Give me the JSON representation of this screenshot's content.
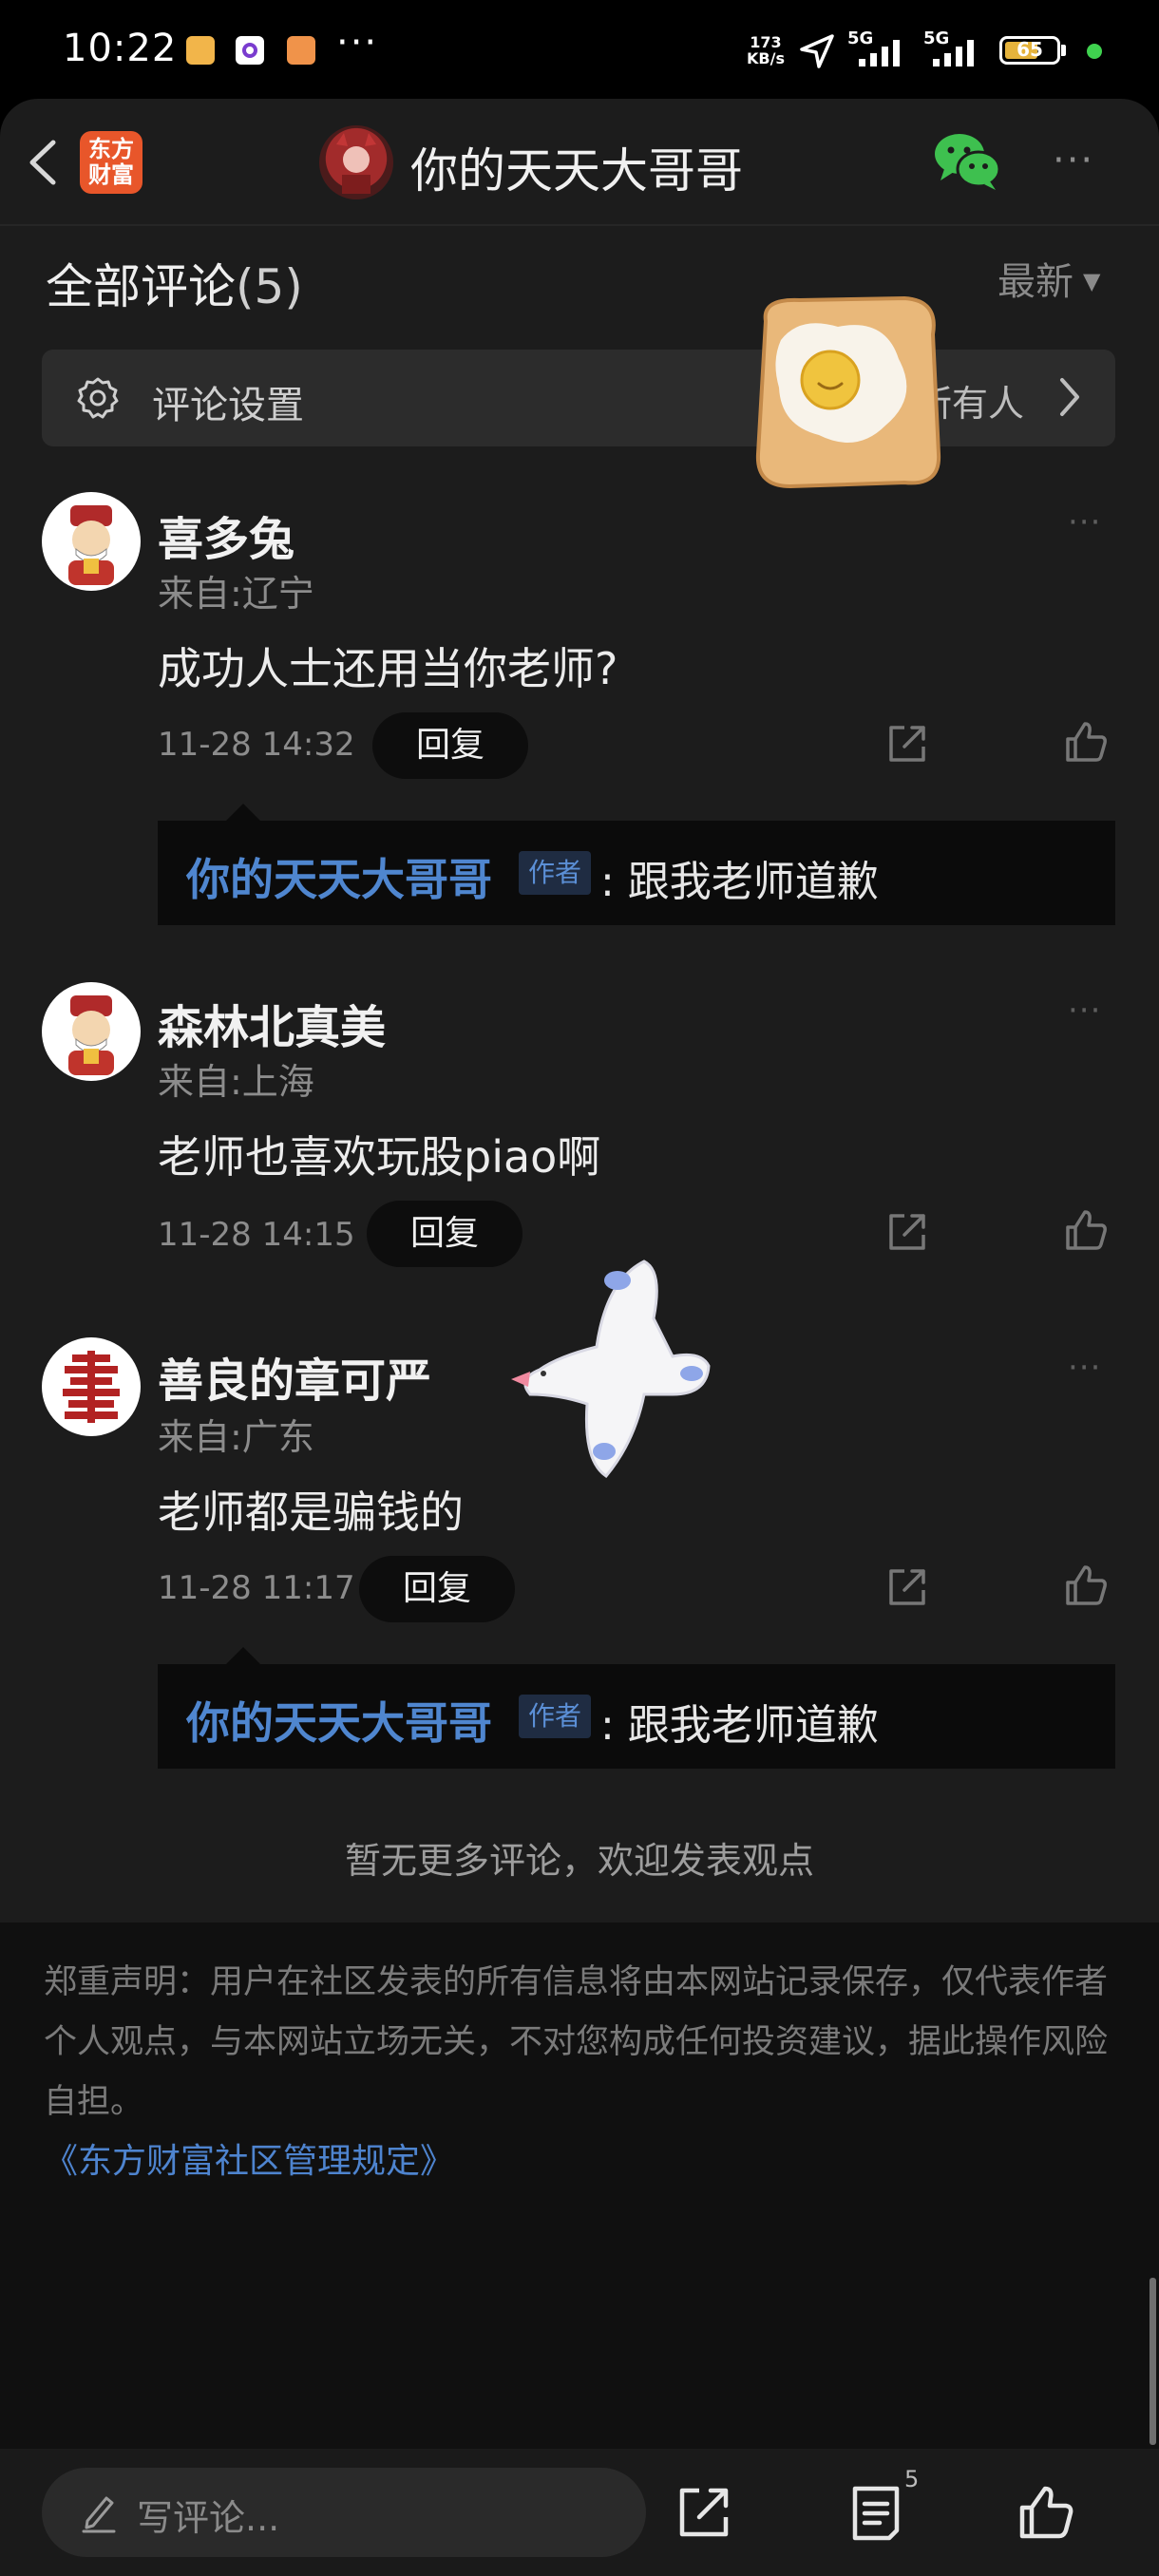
{
  "status_bar": {
    "time": "10:22",
    "more": "···",
    "speed_value": "173",
    "speed_unit": "KB/s",
    "net1": "5G",
    "net2": "5G",
    "battery": "65"
  },
  "header": {
    "title": "你的天天大哥哥",
    "logo_line1": "东方",
    "logo_line2": "财富",
    "more": "···"
  },
  "comments_section": {
    "title": "全部评论",
    "count": "(5)",
    "sort": "最新",
    "settings_label": "评论设置",
    "settings_value": "所有人"
  },
  "comments": [
    {
      "name": "喜多兔",
      "location": "来自:辽宁",
      "text": "成功人士还用当你老师?",
      "time": "11-28 14:32",
      "reply_label": "回复",
      "more": "···",
      "author_reply": {
        "author": "你的天天大哥哥",
        "badge": "作者",
        "text": ": 跟我老师道歉"
      }
    },
    {
      "name": "森林北真美",
      "location": "来自:上海",
      "text": "老师也喜欢玩股piao啊",
      "time": "11-28 14:15",
      "reply_label": "回复",
      "more": "···"
    },
    {
      "name": "善良的章可严",
      "location": "来自:广东",
      "text": "老师都是骗钱的",
      "time": "11-28 11:17",
      "reply_label": "回复",
      "more": "···",
      "author_reply": {
        "author": "你的天天大哥哥",
        "badge": "作者",
        "text": ": 跟我老师道歉"
      }
    }
  ],
  "footer": {
    "no_more": "暂无更多评论，欢迎发表观点",
    "disclaimer": "郑重声明：用户在社区发表的所有信息将由本网站记录保存，仅代表作者个人观点，与本网站立场无关，不对您构成任何投资建议，据此操作风险自担。",
    "rules_link": "《东方财富社区管理规定》"
  },
  "bottom_bar": {
    "placeholder": "写评论...",
    "comment_count": "5"
  },
  "colors": {
    "panel": "#1c1c1c",
    "accent_blue": "#4f86cf",
    "brand_orange": "#e8562a",
    "wechat_green": "#3ec04f"
  }
}
